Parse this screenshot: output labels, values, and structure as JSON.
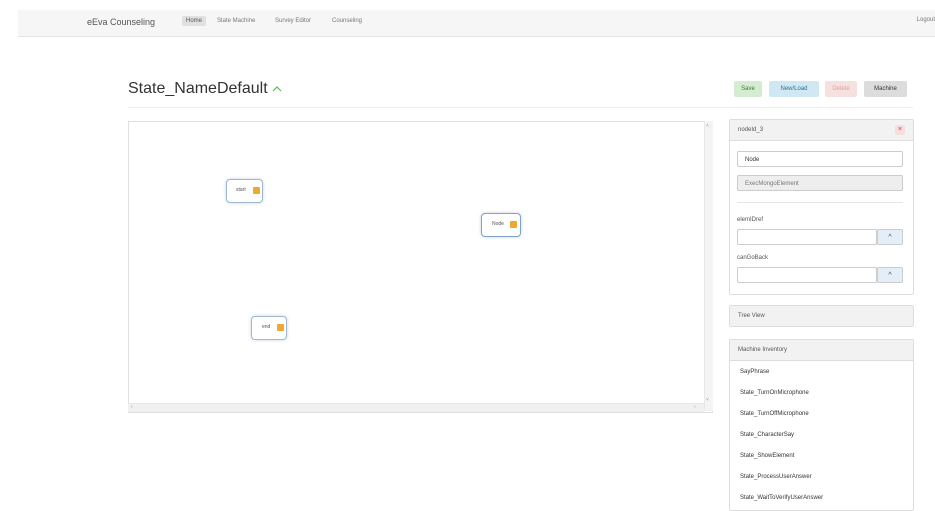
{
  "nav": {
    "brand": "eEva Counseling",
    "items": [
      "Home",
      "State Machine",
      "Survey Editor",
      "Counseling"
    ],
    "logout": "Logout"
  },
  "page": {
    "title": "State_NameDefault"
  },
  "toolbar": {
    "save": "Save",
    "new_load": "New/Load",
    "delete": "Delete",
    "machine": "Machine"
  },
  "canvas": {
    "nodes": [
      {
        "label": "start"
      },
      {
        "label": "Node"
      },
      {
        "label": "end"
      }
    ]
  },
  "props": {
    "header": "nodeId_3",
    "close_icon": "×",
    "name_value": "Node",
    "type_value": "ExecMongoElement",
    "elem_label": "elemIDref",
    "goback_label": "canGoBack",
    "chevron": "^"
  },
  "tree_view": {
    "label": "Tree View"
  },
  "inventory": {
    "header": "Machine Inventory",
    "items": [
      "SayPhrase",
      "State_TurnOnMicrophone",
      "State_TurnOffMicrophone",
      "State_CharacterSay",
      "State_ShowElement",
      "State_ProcessUserAnswer",
      "State_WaitToVerifyUserAnswer"
    ]
  },
  "colors": {
    "accent_green": "#5cb85c",
    "node_port": "#f0a830",
    "node_border": "#9fb8cf"
  }
}
